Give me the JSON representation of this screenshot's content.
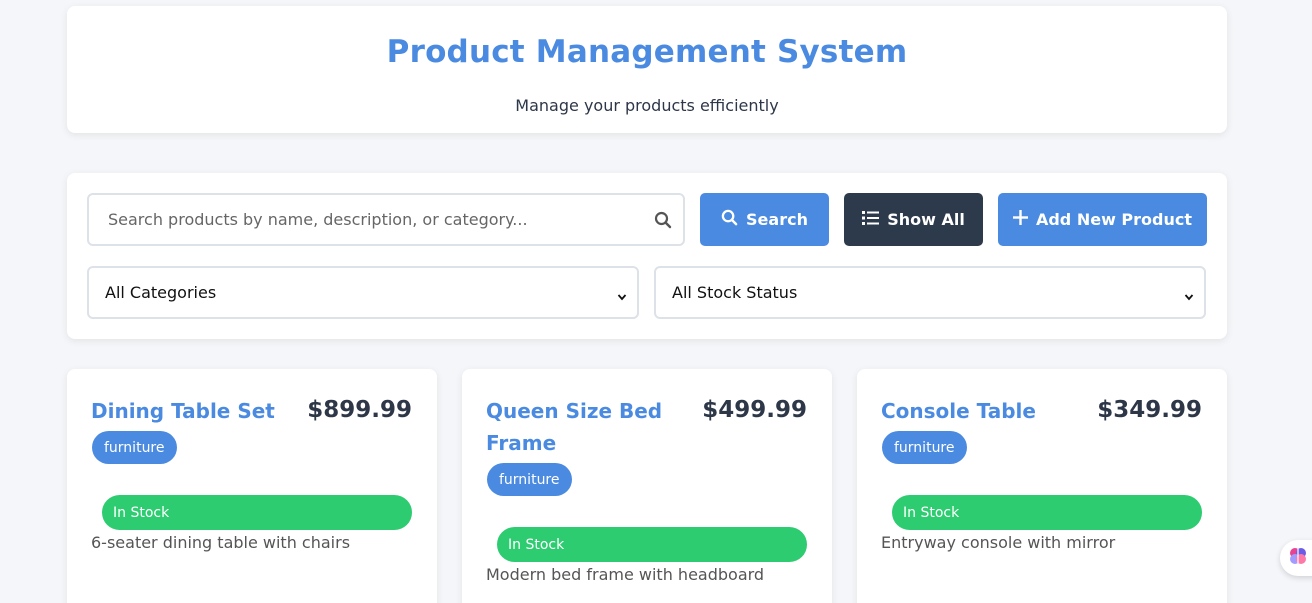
{
  "header": {
    "title": "Product Management System",
    "subtitle": "Manage your products efficiently"
  },
  "toolbar": {
    "search_placeholder": "Search products by name, description, or category...",
    "search_label": "Search",
    "show_all_label": "Show All",
    "add_label": "Add New Product",
    "category_filter": "All Categories",
    "stock_filter": "All Stock Status"
  },
  "products": [
    {
      "name": "Dining Table Set",
      "price": "$899.99",
      "category": "furniture",
      "stock": "In Stock",
      "description": "6-seater dining table with chairs"
    },
    {
      "name": "Queen Size Bed Frame",
      "price": "$499.99",
      "category": "furniture",
      "stock": "In Stock",
      "description": "Modern bed frame with headboard"
    },
    {
      "name": "Console Table",
      "price": "$349.99",
      "category": "furniture",
      "stock": "In Stock",
      "description": "Entryway console with mirror"
    }
  ],
  "colors": {
    "accent": "#4a8ae0",
    "dark_button": "#2d3a4b",
    "in_stock": "#2ecc71",
    "background": "#f4f6f9"
  },
  "icons": {
    "search_field": "search-icon",
    "search_button": "search-icon",
    "show_all_button": "list-icon",
    "add_button": "plus-icon",
    "select": "chevron-down-icon",
    "assistant": "brain-icon"
  }
}
